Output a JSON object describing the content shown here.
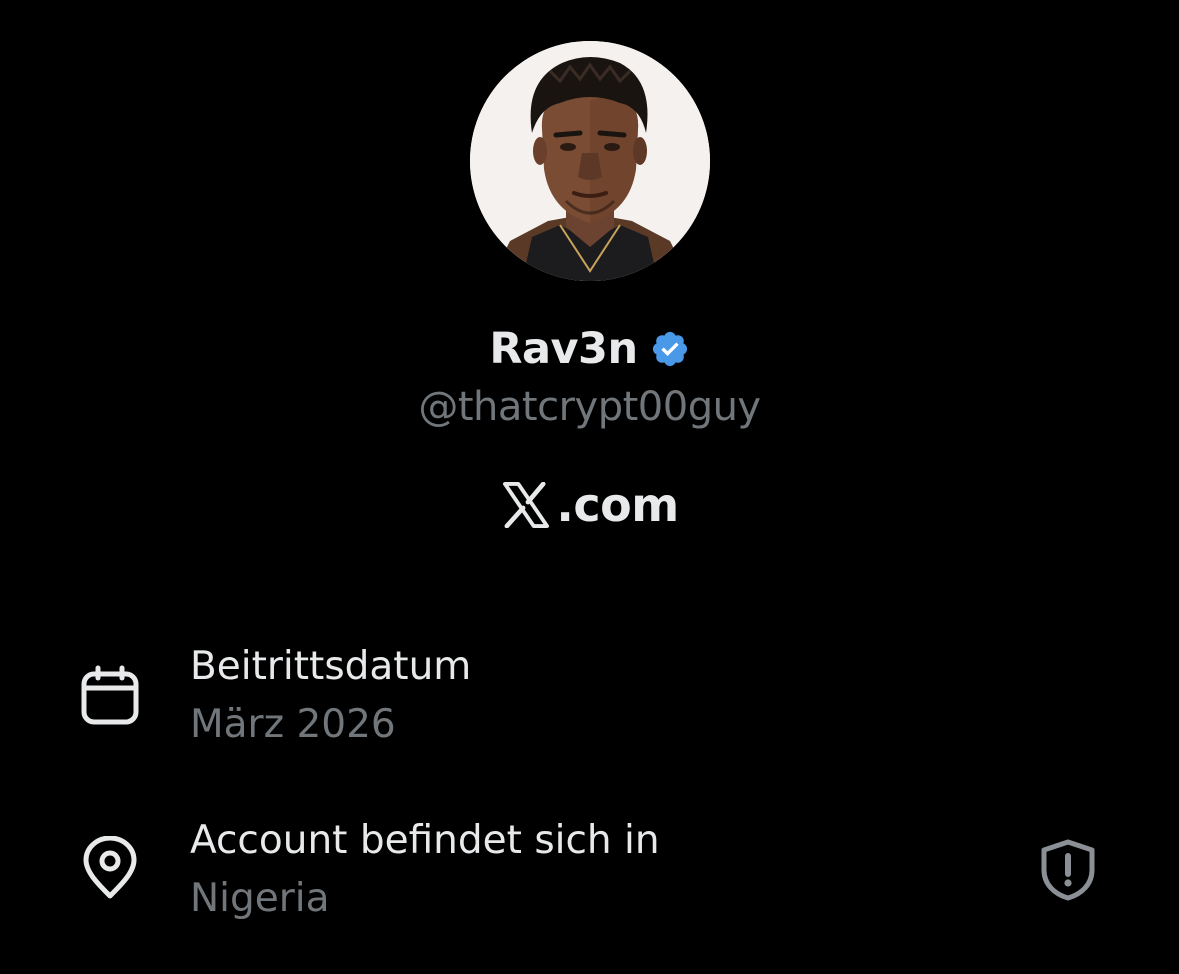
{
  "profile": {
    "display_name": "Rav3n",
    "handle": "@thatcrypt00guy",
    "verified": true,
    "verified_color": "#4a99e9"
  },
  "platform": {
    "logo_icon": "x-logo-icon",
    "domain_text": ".com"
  },
  "about": {
    "joined": {
      "icon": "calendar-icon",
      "label": "Beitrittsdatum",
      "value": "März 2026"
    },
    "location": {
      "icon": "location-pin-icon",
      "label": "Account befindet sich in",
      "value": "Nigeria",
      "trailing_icon": "shield-alert-icon"
    }
  },
  "colors": {
    "background": "#000000",
    "primary_text": "#e7e9ea",
    "secondary_text": "#71767b",
    "verified_badge": "#4a99e9"
  }
}
